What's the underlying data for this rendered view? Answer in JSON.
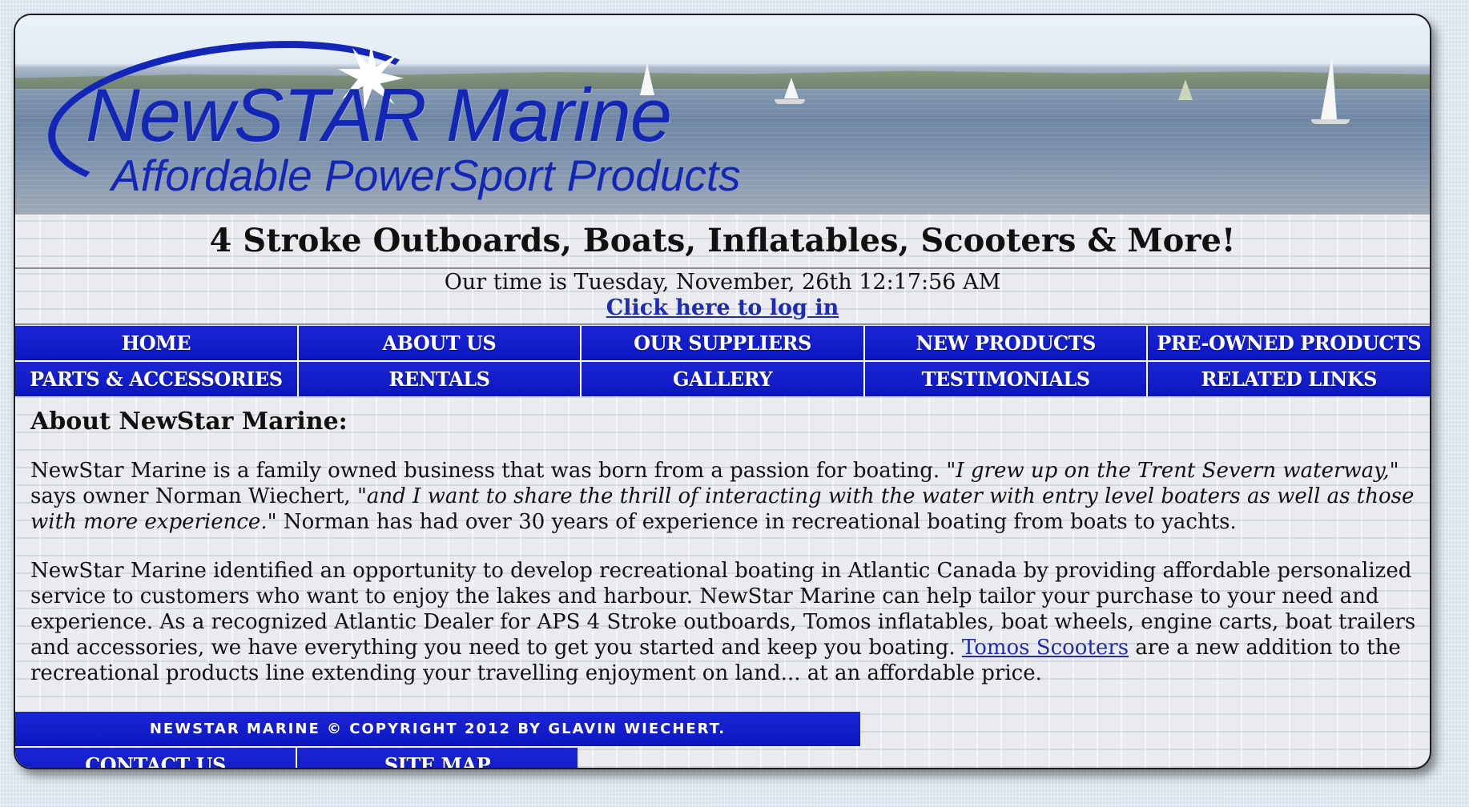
{
  "banner": {
    "logo_name": "NewSTAR Marine",
    "logo_tagline": "Affordable PowerSport Products"
  },
  "headline": "4 Stroke Outboards, Boats, Inflatables, Scooters & More!",
  "clock": {
    "text": "Our time is Tuesday, November, 26th 12:17:56 AM"
  },
  "login_link": "Click here to log in",
  "nav": {
    "row1": [
      "HOME",
      "ABOUT US",
      "OUR SUPPLIERS",
      "NEW PRODUCTS",
      "PRE-OWNED PRODUCTS"
    ],
    "row2": [
      "PARTS & ACCESSORIES",
      "RENTALS",
      "GALLERY",
      "TESTIMONIALS",
      "RELATED LINKS"
    ]
  },
  "content": {
    "heading": "About NewStar Marine:",
    "p1_a": "NewStar Marine is a family owned business that was born from a passion for boating. \"",
    "p1_quote1": "I grew up on the Trent Severn waterway,",
    "p1_b": "\" says owner Norman Wiechert, \"",
    "p1_quote2": "and I want to share the thrill of interacting with the water with entry level boaters as well as those with more experience.",
    "p1_c": "\" Norman has had over 30 years of experience in recreational boating from boats to yachts.",
    "p2_a": "NewStar Marine identified an opportunity to develop recreational boating in Atlantic Canada by providing affordable personalized service to customers who want to enjoy the lakes and harbour. NewStar Marine can help tailor your purchase to your need and experience. As a recognized Atlantic Dealer for APS 4 Stroke outboards, Tomos inflatables, boat wheels, engine carts, boat trailers and accessories, we have everything you need to get you started and keep you boating. ",
    "p2_link": "Tomos Scooters",
    "p2_b": " are a new addition to the recreational products line extending your travelling enjoyment on land... at an affordable price."
  },
  "footer": {
    "copyright": "NEWSTAR MARINE © COPYRIGHT 2012 BY GLAVIN WIECHERT.",
    "links": [
      "CONTACT US",
      "SITE MAP"
    ]
  }
}
